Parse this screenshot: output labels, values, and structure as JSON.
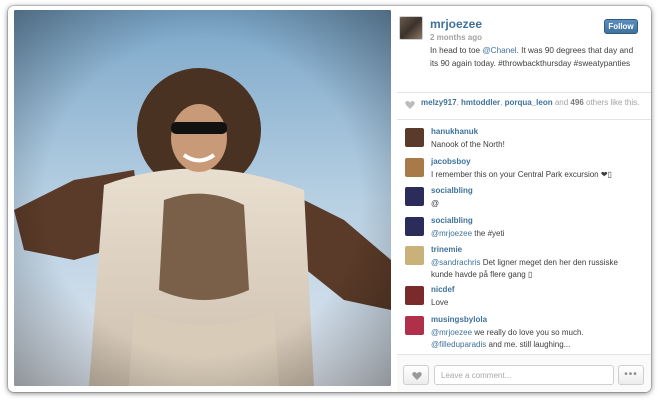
{
  "post": {
    "username": "mrjoezee",
    "time": "2 months ago",
    "follow_label": "Follow",
    "caption_before": "In head to toe ",
    "caption_mention": "@Chanel",
    "caption_after": ". It was 90 degrees that day and its 90 again today. #throwbackthursday #sweatypanties"
  },
  "likes": {
    "user1": "melzy917",
    "sep1": ", ",
    "user2": "hmtoddler",
    "sep2": ", ",
    "user3": "porqua_leon",
    "and_text": " and ",
    "count": "496",
    "suffix": " others like this."
  },
  "comments": [
    {
      "user": "hanukhanuk",
      "mention": "",
      "text": "Nanook of the North!",
      "mention2": "",
      "text2": "",
      "avatar_color": "#5a3a2a"
    },
    {
      "user": "jacobsboy",
      "mention": "",
      "text": "I remember this on your Central Park excursion ❤▯",
      "mention2": "",
      "text2": "",
      "avatar_color": "#a87a4a"
    },
    {
      "user": "socialbling",
      "mention": "",
      "text": "@",
      "mention2": "",
      "text2": "",
      "avatar_color": "#2c2c5a"
    },
    {
      "user": "socialbling",
      "mention": "@mrjoezee",
      "text": " the #yeti",
      "mention2": "",
      "text2": "",
      "avatar_color": "#2c2c5a"
    },
    {
      "user": "trinemie",
      "mention": "@sandrachris",
      "text": " Det ligner meget den her den russiske kunde havde på flere gang ▯",
      "mention2": "",
      "text2": "",
      "avatar_color": "#c9b27a"
    },
    {
      "user": "nicdef",
      "mention": "",
      "text": "Love",
      "mention2": "",
      "text2": "",
      "avatar_color": "#7a2a2a"
    },
    {
      "user": "musingsbylola",
      "mention": "@mrjoezee",
      "text": " we really do love you so much.",
      "mention2": "@filleduparadis",
      "text2": " and me. still laughing...",
      "avatar_color": "#b0304a"
    }
  ],
  "footer": {
    "comment_placeholder": "Leave a comment...",
    "more_label": "•••"
  },
  "colors": {
    "link": "#3f729b",
    "follow_button": "#3f729b",
    "muted": "#a2a2a2"
  },
  "icons": {
    "likes_heart": "heart-icon",
    "like_button": "heart-icon",
    "more": "ellipsis-icon"
  }
}
